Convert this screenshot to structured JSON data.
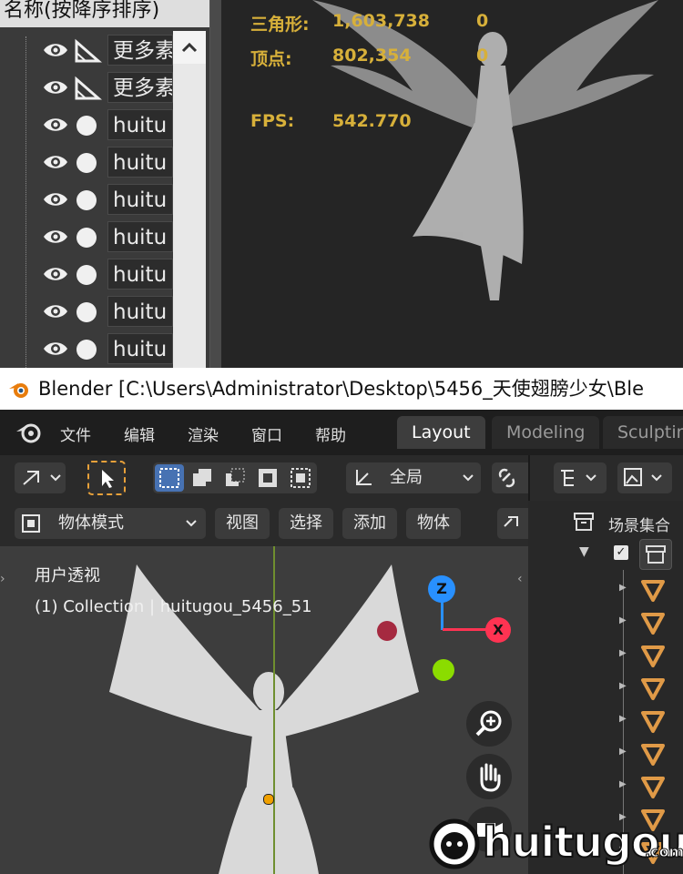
{
  "list_panel": {
    "header": "名称(按降序排序)",
    "scroll_up_glyph": "^",
    "rows": [
      {
        "label": "更多素",
        "shape": "triangle"
      },
      {
        "label": "更多素",
        "shape": "triangle"
      },
      {
        "label": "huitu",
        "shape": "circle"
      },
      {
        "label": "huitu",
        "shape": "circle"
      },
      {
        "label": "huitu",
        "shape": "circle"
      },
      {
        "label": "huitu",
        "shape": "circle"
      },
      {
        "label": "huitu",
        "shape": "circle"
      },
      {
        "label": "huitu",
        "shape": "circle"
      },
      {
        "label": "huitu",
        "shape": "circle"
      }
    ]
  },
  "stats": {
    "triangles_label": "三角形:",
    "triangles_value": "1,603,738",
    "triangles_selected": "0",
    "vertices_label": "顶点:",
    "vertices_value": "802,354",
    "vertices_selected": "0",
    "fps_label": "FPS:",
    "fps_value": "542.770"
  },
  "titlebar": {
    "title": "Blender [C:\\Users\\Administrator\\Desktop\\5456_天使翅膀少女\\Ble"
  },
  "menubar": {
    "items": [
      "文件",
      "编辑",
      "渲染",
      "窗口",
      "帮助"
    ],
    "tabs": [
      {
        "label": "Layout",
        "active": true
      },
      {
        "label": "Modeling",
        "active": false
      },
      {
        "label": "Sculptin",
        "active": false
      }
    ]
  },
  "toolbar": {
    "transform_orientation": "全局",
    "mode": "物体模式",
    "menus": [
      "视图",
      "选择",
      "添加",
      "物体"
    ]
  },
  "viewport": {
    "view_name": "用户透视",
    "object_info": "(1) Collection | huitugou_5456_51",
    "gizmo": {
      "z": "Z",
      "x": "X"
    }
  },
  "outliner": {
    "scene_collection": "场景集合",
    "child_count": 9
  },
  "watermark": {
    "brand": "huitugou",
    "suffix": ".com"
  },
  "colors": {
    "accent_blue": "#4772b3",
    "stats_yellow": "#d7b03a",
    "axis_x": "#ff3352",
    "axis_y": "#8bdc00",
    "axis_z": "#2890ff",
    "outliner_mesh_orange": "#e09a47"
  }
}
